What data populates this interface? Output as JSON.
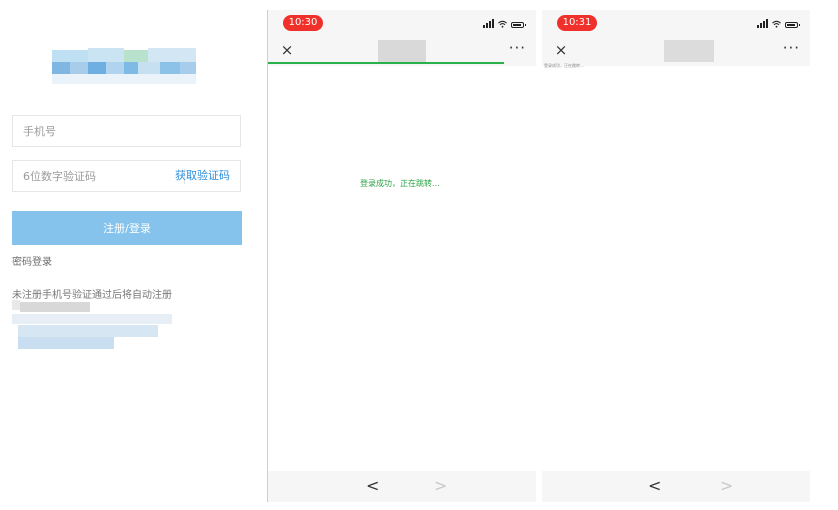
{
  "login": {
    "phone_placeholder": "手机号",
    "code_placeholder": "6位数字验证码",
    "get_code_label": "获取验证码",
    "submit_label": "注册/登录",
    "password_login_label": "密码登录",
    "notice_text": "未注册手机号验证通过后将自动注册"
  },
  "phone1": {
    "time": "10:30",
    "menu_label": "···",
    "close_label": "×",
    "status_message": "登录成功，正在跳转...",
    "back_label": "<",
    "forward_label": ">",
    "page_load_progress": 0.88
  },
  "phone2": {
    "time": "10:31",
    "menu_label": "···",
    "close_label": "×",
    "status_message_small": "登录成功，正在跳转...",
    "back_label": "<",
    "forward_label": ">"
  },
  "colors": {
    "accent_button": "#86c3ec",
    "link_blue": "#2d8fdc",
    "success_green": "#2ab14a",
    "time_pill_red": "#f0302a"
  },
  "icons": [
    "close-icon",
    "more-icon",
    "signal-icon",
    "wifi-icon",
    "battery-icon",
    "chevron-left-icon",
    "chevron-right-icon"
  ]
}
